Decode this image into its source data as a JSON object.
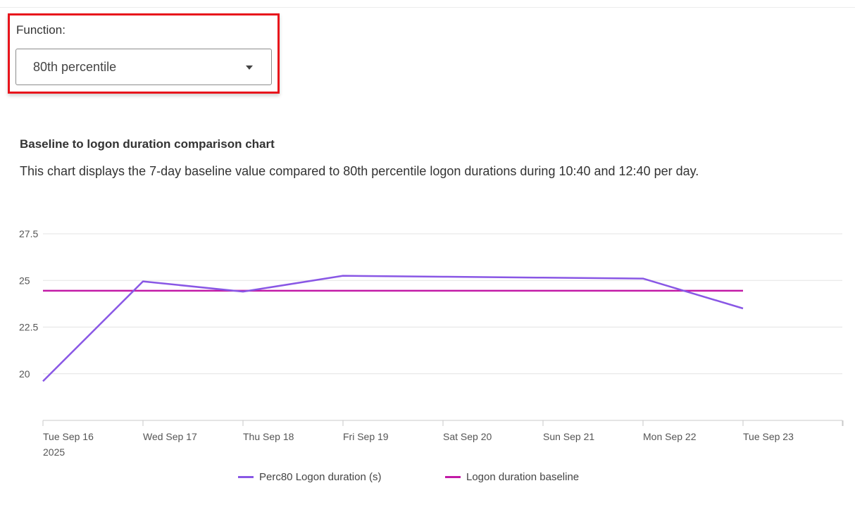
{
  "function_selector": {
    "label": "Function:",
    "selected": "80th percentile"
  },
  "chart_header": {
    "title": "Baseline to logon duration comparison chart",
    "description": "This chart displays the 7-day baseline value compared to 80th percentile logon durations during 10:40 and 12:40 per day."
  },
  "colors": {
    "perc80": "#8957e5",
    "baseline": "#c21aa6",
    "highlight_border": "#e8141c",
    "grid": "#e3e3e3"
  },
  "chart_data": {
    "type": "line",
    "x": [
      "Tue Sep 16",
      "Wed Sep 17",
      "Thu Sep 18",
      "Fri Sep 19",
      "Sat Sep 20",
      "Sun Sep 21",
      "Mon Sep 22",
      "Tue Sep 23"
    ],
    "x_tick_labels": [
      "Tue Sep 16",
      "Wed Sep 17",
      "Thu Sep 18",
      "Fri Sep 19",
      "Sat Sep 20",
      "Sun Sep 21",
      "Mon Sep 22",
      "Tue Sep 23"
    ],
    "x_sub_label": "2025",
    "y_ticks": [
      27.5,
      25,
      22.5,
      20
    ],
    "y_tick_labels": [
      "27.5",
      "25",
      "22.5",
      "20"
    ],
    "ylim": [
      17.5,
      27.5
    ],
    "grid": true,
    "legend_position": "bottom",
    "series": [
      {
        "name": "Perc80 Logon duration (s)",
        "values": [
          19.6,
          24.95,
          24.4,
          25.25,
          25.2,
          25.15,
          25.1,
          23.5
        ]
      },
      {
        "name": "Logon duration baseline",
        "values": [
          24.45,
          24.45,
          24.45,
          24.45,
          24.45,
          24.45,
          24.45,
          24.45
        ]
      }
    ]
  }
}
